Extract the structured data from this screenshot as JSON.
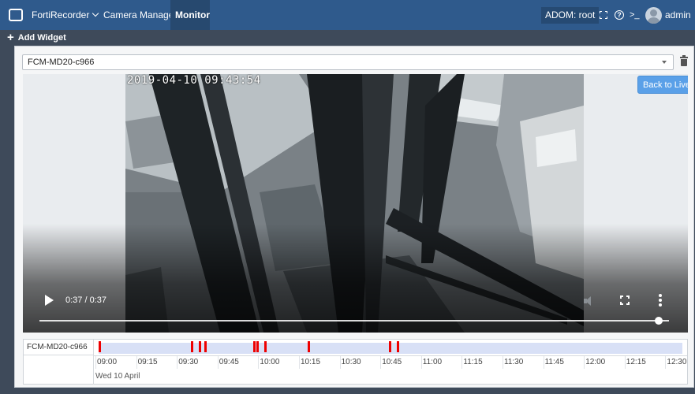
{
  "topbar": {
    "app_name": "FortiRecorder",
    "nav": [
      {
        "label": "Camera Manager"
      },
      {
        "label": "Monitor"
      }
    ],
    "adom": "ADOM: root",
    "terminal_glyph": ">_",
    "help_glyph": "?",
    "user": "admin"
  },
  "toolbar": {
    "add_widget": "Add Widget"
  },
  "widget": {
    "camera_select": "FCM-MD20-c966",
    "video": {
      "osd_timestamp": "2019-04-10 09:43:54",
      "back_to_live": "Back to Live",
      "time_display": "0:37 / 0:37",
      "progress_percent": 100
    },
    "timeline": {
      "camera_label": "FCM-MD20-c966",
      "ticks": [
        "09:00",
        "09:15",
        "09:30",
        "09:45",
        "10:00",
        "10:15",
        "10:30",
        "10:45",
        "11:00",
        "11:15",
        "11:30",
        "11:45",
        "12:00",
        "12:15",
        "12:30"
      ],
      "date_label": "Wed 10 April",
      "event_times": [
        "09:00",
        "09:34",
        "09:37",
        "09:39",
        "09:57",
        "09:58",
        "10:01",
        "10:17",
        "10:47",
        "10:50"
      ],
      "event_color": "#ee0000",
      "track_color": "#d8e0f6"
    }
  },
  "colors": {
    "topbar_bg": "#2f5a8c",
    "accent": "#5aa0e8"
  }
}
